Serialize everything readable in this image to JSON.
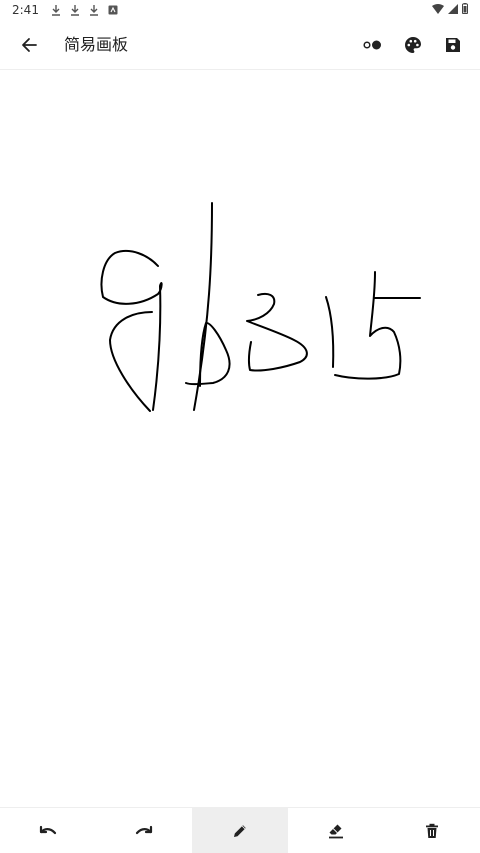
{
  "status_bar": {
    "time": "2:41",
    "notification_icons": [
      "download-icon",
      "download-icon",
      "download-icon",
      "app-notification-icon"
    ],
    "system_icons": [
      "wifi-icon",
      "signal-icon",
      "battery-icon"
    ]
  },
  "app_bar": {
    "title": "简易画板",
    "back_icon": "arrow-back-icon",
    "actions": [
      {
        "name": "stroke-size-button",
        "icon": "stroke-size-icon"
      },
      {
        "name": "color-palette-button",
        "icon": "palette-icon"
      },
      {
        "name": "save-button",
        "icon": "save-icon"
      }
    ]
  },
  "canvas": {
    "stroke_color": "#000000",
    "background": "#ffffff"
  },
  "toolbar": {
    "tools": [
      {
        "name": "undo-button",
        "icon": "undo-icon",
        "selected": false
      },
      {
        "name": "redo-button",
        "icon": "redo-icon",
        "selected": false
      },
      {
        "name": "pen-button",
        "icon": "pencil-icon",
        "selected": true
      },
      {
        "name": "eraser-button",
        "icon": "eraser-icon",
        "selected": false
      },
      {
        "name": "clear-button",
        "icon": "delete-icon",
        "selected": false
      }
    ],
    "selected_bg": "#eeeeee"
  }
}
